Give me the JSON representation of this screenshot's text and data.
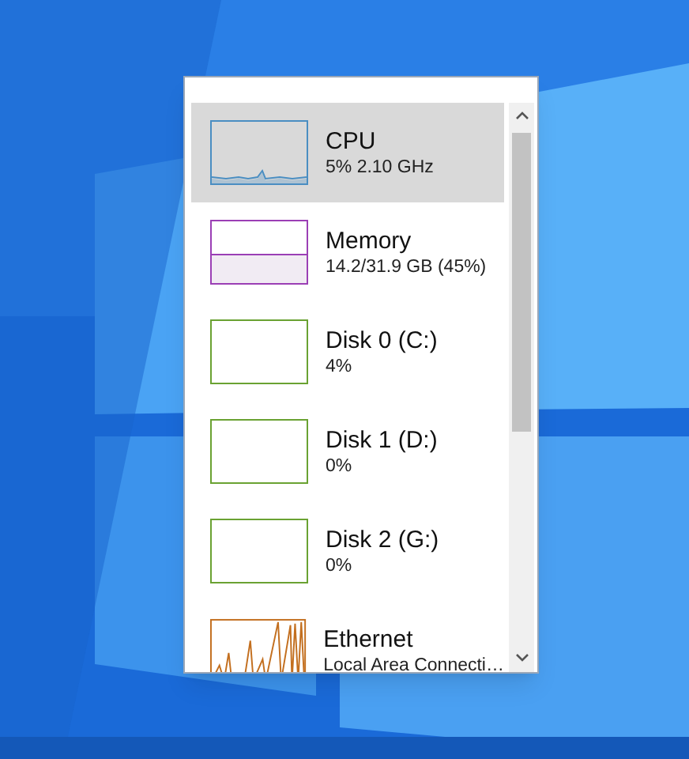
{
  "performance_list": [
    {
      "name": "CPU",
      "reading": "5% 2.10 GHz",
      "kind": "cpu",
      "color": "#4a8ec2",
      "selected": true
    },
    {
      "name": "Memory",
      "reading": "14.2/31.9 GB (45%)",
      "kind": "memory",
      "color": "#9b3fb5",
      "selected": false
    },
    {
      "name": "Disk 0 (C:)",
      "reading": "4%",
      "kind": "disk",
      "color": "#6aa232",
      "selected": false
    },
    {
      "name": "Disk 1 (D:)",
      "reading": "0%",
      "kind": "disk",
      "color": "#6aa232",
      "selected": false
    },
    {
      "name": "Disk 2 (G:)",
      "reading": "0%",
      "kind": "disk",
      "color": "#6aa232",
      "selected": false
    },
    {
      "name": "Ethernet",
      "reading": "Local Area Connecti…",
      "kind": "ethernet",
      "color": "#c36f1f",
      "selected": false
    }
  ]
}
